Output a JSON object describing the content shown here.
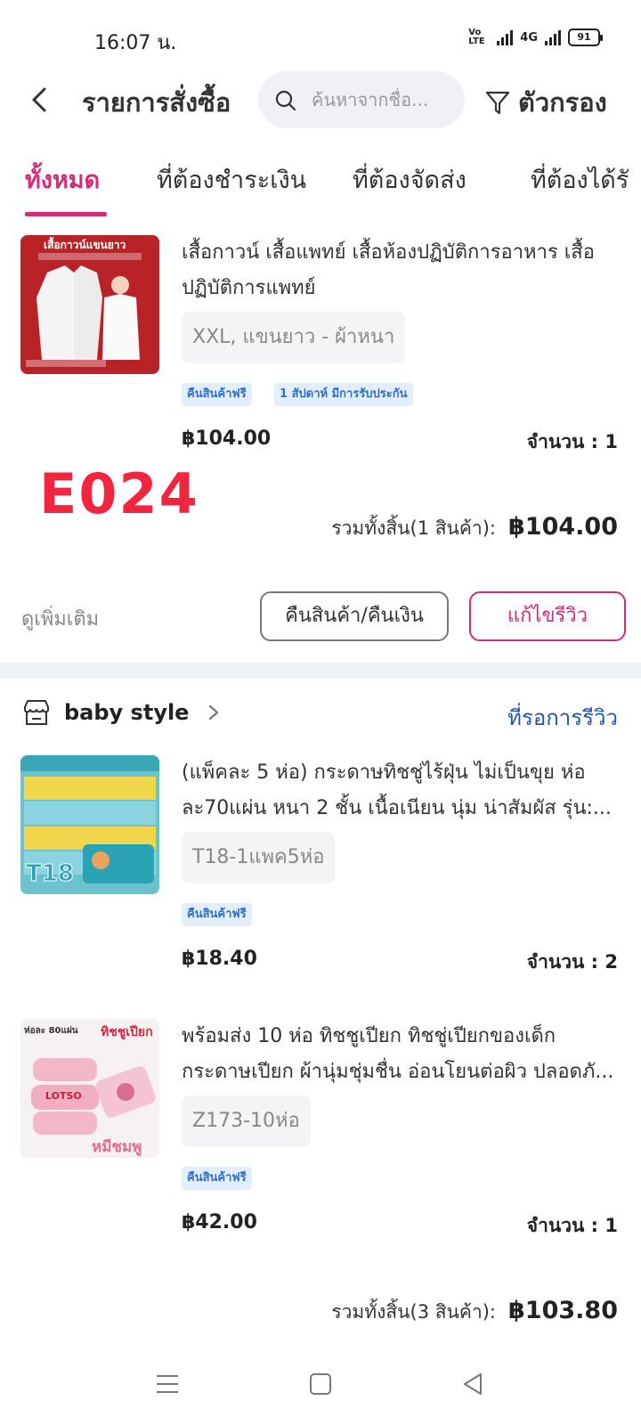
{
  "status_bar": {
    "time": "16:07 น.",
    "network_volte": "Vo LTE",
    "network_4g": "4G",
    "battery": "91"
  },
  "header": {
    "title": "รายการสั่งซื้อ",
    "search_placeholder": "ค้นหาจากชื่อ...",
    "filter_label": "ตัวกรอง"
  },
  "tabs": [
    {
      "label": "ทั้งหมด",
      "active": true
    },
    {
      "label": "ที่ต้องชำระเงิน",
      "active": false
    },
    {
      "label": "ที่ต้องจัดส่ง",
      "active": false
    },
    {
      "label": "ที่ต้องได้รั",
      "active": false
    }
  ],
  "orders": [
    {
      "items": [
        {
          "name": "เสื้อกาวน์ เสื้อแพทย์ เสื้อห้องปฏิบัติการอาหาร เสื้อปฏิบัติการแพทย์",
          "variant": "XXL, แขนยาว - ผ้าหนา",
          "badges": [
            "คืนสินค้าฟรี",
            "1 สัปดาห์ มีการรับประกัน"
          ],
          "price": "฿104.00",
          "quantity": "จำนวน : 1",
          "thumb_text": "เสื้อกาวน์แขนยาว"
        }
      ],
      "watermark": "E024",
      "total_label": "รวมทั้งสิ้น(1 สินค้า):",
      "total_amount": "฿104.00",
      "more_label": "ดูเพิ่มเติม",
      "return_button": "คืนสินค้า/คืนเงิน",
      "review_button": "แก้ไขรีวิว"
    },
    {
      "shop_name": "baby style",
      "status": "ที่รอการรีวิว",
      "items": [
        {
          "name": "(แพ็คละ 5 ห่อ) กระดาษทิชชู่ไร้ฝุ่น ไม่เป็นขุย ห่อละ70แผ่น หนา 2 ชั้น เนื้อเนียน นุ่ม น่าสัมผัส รุ่น:...",
          "variant": "T18-1แพค5ห่อ",
          "badges": [
            "คืนสินค้าฟรี"
          ],
          "price": "฿18.40",
          "quantity": "จำนวน : 2",
          "thumb_text": "T18"
        },
        {
          "name": "พร้อมส่ง 10 ห่อ ทิชชูเปียก ทิชชู่เปียกของเด็ก กระดาษเปียก ผ้านุ่มชุ่มชื่น อ่อนโยนต่อผิว ปลอดภั...",
          "variant": "Z173-10ห่อ",
          "badges": [
            "คืนสินค้าฟรี"
          ],
          "price": "฿42.00",
          "quantity": "จำนวน : 1",
          "thumb_text": "ทิชชูเปียก",
          "thumb_sub": "ห่อละ 80แผ่น",
          "thumb_brand": "LOTSO",
          "thumb_color": "หมีชมพู"
        }
      ],
      "total_label": "รวมทั้งสิ้น(3 สินค้า):",
      "total_amount": "฿103.80"
    }
  ],
  "colors": {
    "accent": "#d62a78",
    "link": "#2554a6",
    "badge_bg": "#e3eefc",
    "badge_text": "#2d6fcf",
    "watermark": "#f0263f"
  }
}
